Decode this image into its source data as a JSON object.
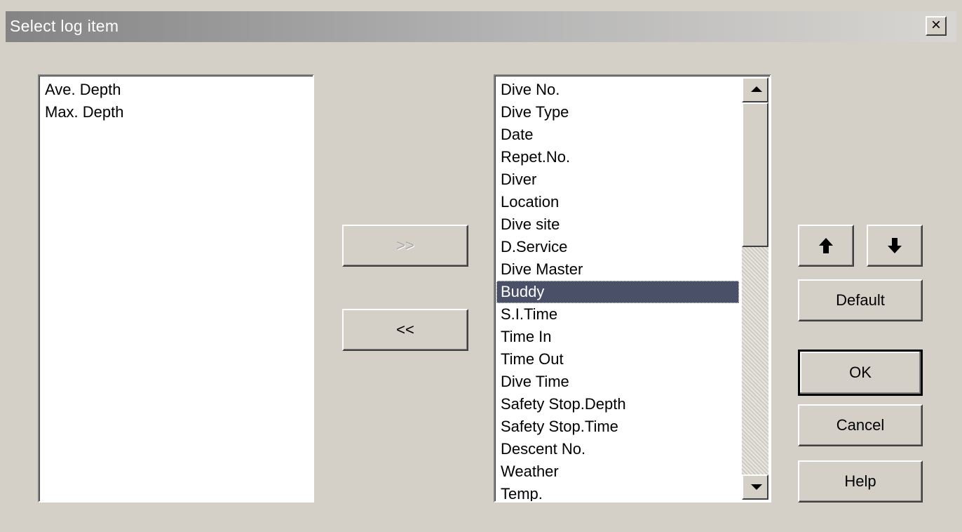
{
  "window": {
    "title": "Select log item",
    "close_glyph": "×"
  },
  "left_list": {
    "items": [
      "Ave. Depth",
      "Max. Depth"
    ]
  },
  "right_list": {
    "items": [
      "Dive No.",
      "Dive Type",
      "Date",
      "Repet.No.",
      "Diver",
      "Location",
      "Dive site",
      "D.Service",
      "Dive Master",
      "Buddy",
      "S.I.Time",
      "Time In",
      "Time Out",
      "Dive Time",
      "Safety Stop.Depth",
      "Safety Stop.Time",
      "Descent No.",
      "Weather",
      "Temp."
    ],
    "selected": "Buddy"
  },
  "buttons": {
    "add": ">>",
    "remove": "<<",
    "move_up_icon": "arrow-up-icon",
    "move_down_icon": "arrow-down-icon",
    "default": "Default",
    "ok": "OK",
    "cancel": "Cancel",
    "help": "Help"
  },
  "colors": {
    "selection": "#4a5068",
    "face": "#d4d0c8"
  }
}
